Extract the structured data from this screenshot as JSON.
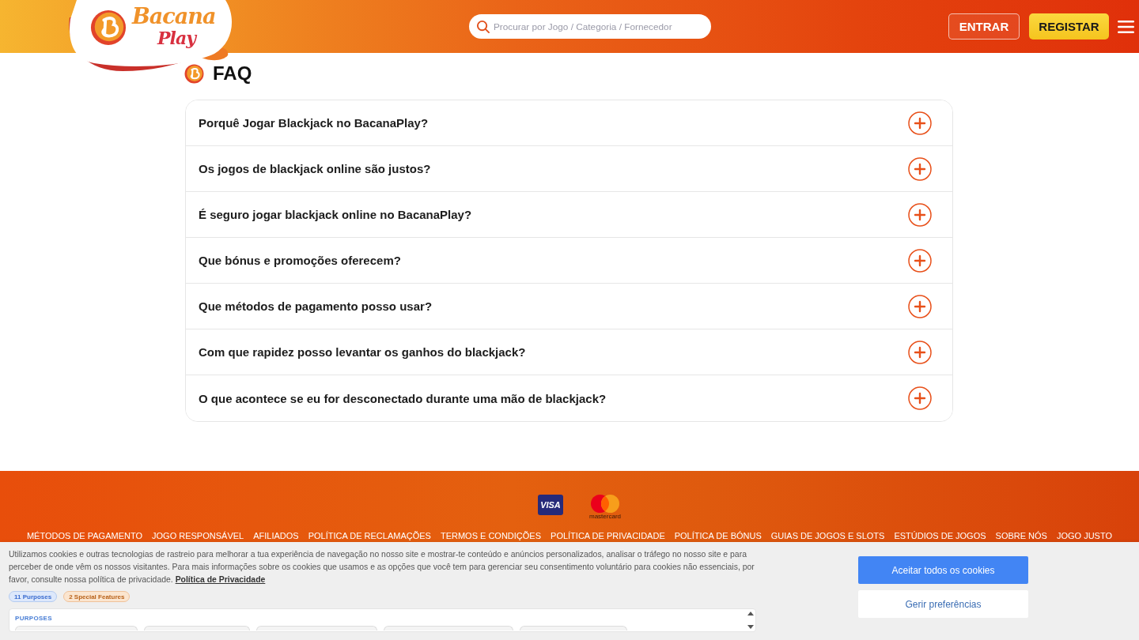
{
  "header": {
    "logo": {
      "line_1": "Bacana",
      "line_2": "Play"
    },
    "search": {
      "placeholder": "Procurar por Jogo / Categoria / Fornecedor"
    },
    "buttons": [
      {
        "label": "ENTRAR",
        "kind": "outline"
      },
      {
        "label": "REGISTAR",
        "kind": "primary"
      }
    ]
  },
  "faq": {
    "title": "FAQ",
    "items": [
      {
        "question": "Porquê Jogar Blackjack no BacanaPlay?",
        "expanded": false
      },
      {
        "question": "Os jogos de blackjack online são justos?",
        "expanded": false
      },
      {
        "question": "É seguro jogar blackjack online no BacanaPlay?",
        "expanded": false
      },
      {
        "question": "Que bónus e promoções oferecem?",
        "expanded": false
      },
      {
        "question": "Que métodos de pagamento posso usar?",
        "expanded": false
      },
      {
        "question": "Com que rapidez posso levantar os ganhos do blackjack?",
        "expanded": false
      },
      {
        "question": "O que acontece se eu for desconectado durante uma mão de blackjack?",
        "expanded": false
      }
    ]
  },
  "footer": {
    "payment_methods": [
      {
        "kind": "visa",
        "label": "VISA"
      },
      {
        "kind": "mastercard",
        "label": "mastercard"
      }
    ],
    "links": [
      "MÉTODOS DE PAGAMENTO",
      "JOGO RESPONSÁVEL",
      "AFILIADOS",
      "POLÍTICA DE RECLAMAÇÕES",
      "TERMOS E CONDIÇÕES",
      "POLÍTICA DE PRIVACIDADE",
      "POLÍTICA DE BÓNUS",
      "GUIAS DE JOGOS E SLOTS",
      "ESTÚDIOS DE JOGOS",
      "SOBRE NÓS",
      "JOGO JUSTO"
    ]
  },
  "cookie_banner": {
    "text": "Utilizamos cookies e outras tecnologias de rastreio para melhorar a tua experiência de navegação no nosso site e mostrar-te conteúdo e anúncios personalizados, analisar o tráfego no nosso site e para perceber de onde vêm os nossos visitantes. Para mais informações sobre os cookies que usamos e as opções que você tem para gerenciar seu consentimento voluntário para cookies não essenciais, por favor, consulte nossa política de privacidade.",
    "link": "Política de Privacidade",
    "badges": [
      {
        "label": "11 Purposes",
        "kind": "purposes"
      },
      {
        "label": "2 Special Features",
        "kind": "features"
      }
    ],
    "section_title": "PURPOSES",
    "buttons": [
      {
        "label": "Aceitar todos os cookies",
        "kind": "primary"
      },
      {
        "label": "Gerir preferências",
        "kind": "secondary"
      }
    ]
  }
}
